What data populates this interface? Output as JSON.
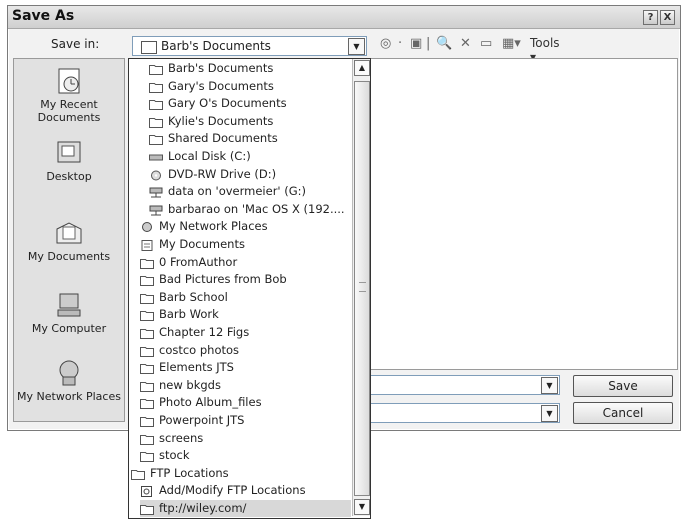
{
  "dialog": {
    "title": "Save As",
    "help_label": "?",
    "close_label": "X",
    "save_in_label": "Save in:",
    "save_in_value": "Barb's Documents",
    "tools_label": "Tools"
  },
  "places": [
    {
      "label": "My Recent Documents",
      "icon": "recent-documents-icon"
    },
    {
      "label": "Desktop",
      "icon": "desktop-icon"
    },
    {
      "label": "My Documents",
      "icon": "my-documents-icon"
    },
    {
      "label": "My Computer",
      "icon": "my-computer-icon"
    },
    {
      "label": "My Network Places",
      "icon": "network-places-icon"
    }
  ],
  "buttons": {
    "save": "Save",
    "cancel": "Cancel"
  },
  "dropdown_items": [
    {
      "label": "Barb's Documents",
      "icon": "folder",
      "indent": 2
    },
    {
      "label": "Gary's Documents",
      "icon": "folder",
      "indent": 2
    },
    {
      "label": "Gary O's Documents",
      "icon": "folder",
      "indent": 2
    },
    {
      "label": "Kylie's Documents",
      "icon": "folder",
      "indent": 2
    },
    {
      "label": "Shared Documents",
      "icon": "folder",
      "indent": 2
    },
    {
      "label": "Local Disk (C:)",
      "icon": "disk",
      "indent": 2
    },
    {
      "label": "DVD-RW Drive (D:)",
      "icon": "dvd",
      "indent": 2
    },
    {
      "label": "data on 'overmeier' (G:)",
      "icon": "network-drive",
      "indent": 2
    },
    {
      "label": "barbarao on 'Mac OS X (192....",
      "icon": "network-drive",
      "indent": 2
    },
    {
      "label": "My Network Places",
      "icon": "network",
      "indent": 1
    },
    {
      "label": "My Documents",
      "icon": "documents",
      "indent": 1
    },
    {
      "label": "0 FromAuthor",
      "icon": "folder",
      "indent": 1
    },
    {
      "label": "Bad Pictures from Bob",
      "icon": "folder",
      "indent": 1
    },
    {
      "label": "Barb School",
      "icon": "folder",
      "indent": 1
    },
    {
      "label": "Barb Work",
      "icon": "folder",
      "indent": 1
    },
    {
      "label": "Chapter 12 Figs",
      "icon": "folder",
      "indent": 1
    },
    {
      "label": "costco photos",
      "icon": "folder",
      "indent": 1
    },
    {
      "label": "Elements JTS",
      "icon": "folder",
      "indent": 1
    },
    {
      "label": "new bkgds",
      "icon": "folder",
      "indent": 1
    },
    {
      "label": "Photo Album_files",
      "icon": "folder",
      "indent": 1
    },
    {
      "label": "Powerpoint JTS",
      "icon": "folder",
      "indent": 1
    },
    {
      "label": "screens",
      "icon": "folder",
      "indent": 1
    },
    {
      "label": "stock",
      "icon": "folder",
      "indent": 1
    },
    {
      "label": "FTP Locations",
      "icon": "folder",
      "indent": 0
    },
    {
      "label": "Add/Modify FTP Locations",
      "icon": "ftp",
      "indent": 1
    },
    {
      "label": "ftp://wiley.com/",
      "icon": "folder",
      "indent": 1,
      "selected": true
    }
  ]
}
